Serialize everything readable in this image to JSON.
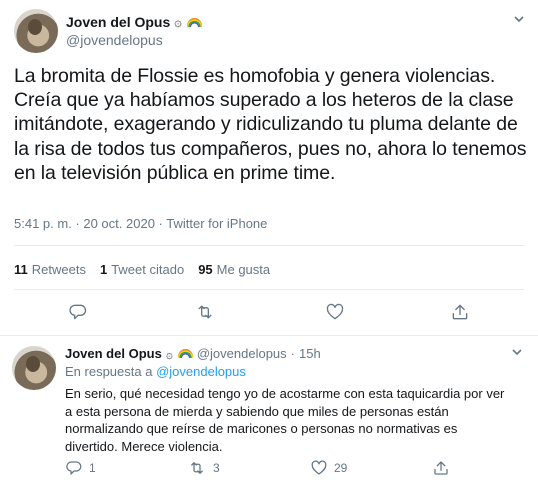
{
  "main_tweet": {
    "author_name": "Joven del Opus",
    "author_handle": "@jovendelopus",
    "text": "La bromita de Flossie es homofobia y genera violencias. Creía que ya habíamos superado a los heteros de la clase imitándote, exagerando y ridiculizando tu pluma delante de la risa de todos tus compañeros, pues no, ahora lo tenemos en la televisión pública en prime time.",
    "timestamp": "5:41 p. m. · 20 oct. 2020 · Twitter for iPhone",
    "retweets_count": "11",
    "retweets_label": "Retweets",
    "quotes_count": "1",
    "quotes_label": "Tweet citado",
    "likes_count": "95",
    "likes_label": "Me gusta"
  },
  "reply_tweet": {
    "author_name": "Joven del Opus",
    "author_handle": "@jovendelopus",
    "time_ago": "15h",
    "reply_prefix": "En respuesta a",
    "reply_target": "@jovendelopus",
    "text": "En serio, qué necesidad tengo yo de acostarme con esta taquicardia por ver a esta persona de mierda y sabiendo que miles de personas están normalizando que reírse de maricones o personas no normativas es divertido. Merece violencia.",
    "reply_count": "1",
    "retweet_count": "3",
    "like_count": "29"
  },
  "icons": {
    "badge": "sun-seal-emoji",
    "flag": "rainbow-emoji",
    "menu": "chevron-down-icon",
    "reply": "reply-icon",
    "retweet": "retweet-icon",
    "like": "heart-icon",
    "share": "share-icon"
  },
  "colors": {
    "text": "#14171a",
    "secondary": "#657786",
    "link": "#1da1f2",
    "divider": "#e6ecf0"
  }
}
